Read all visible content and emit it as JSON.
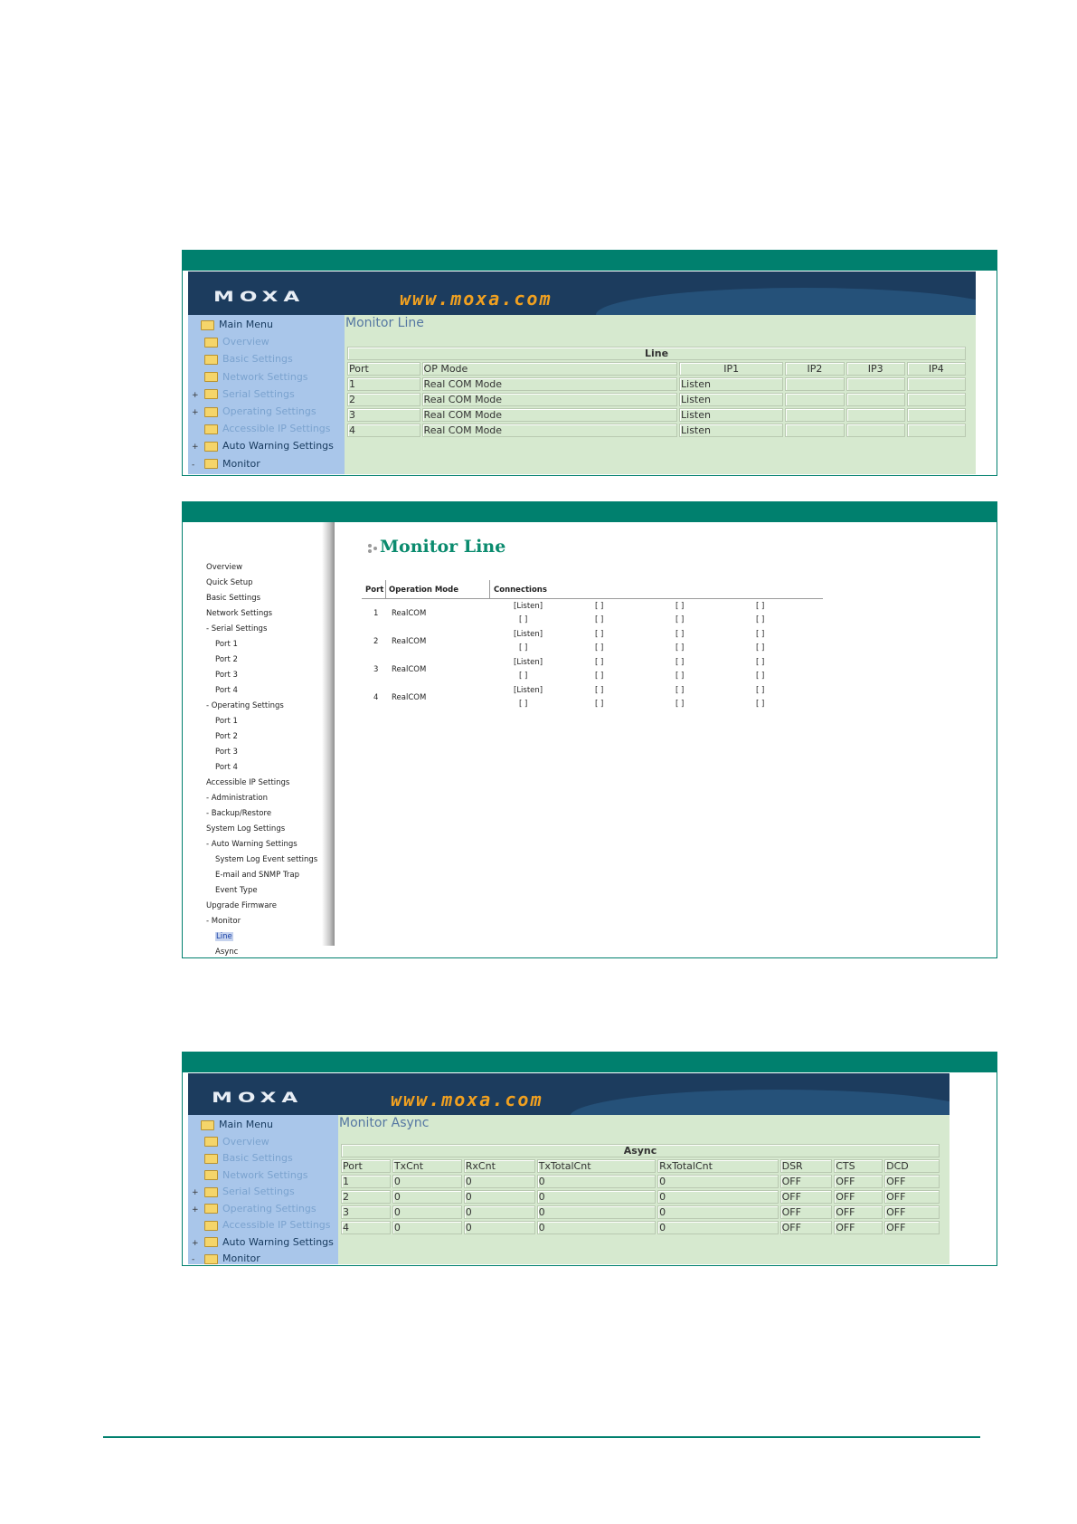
{
  "shot1": {
    "logo": "MOXA",
    "url": "www.moxa.com",
    "menu": [
      {
        "label": "Main Menu",
        "expander": "",
        "style": "dark",
        "open": true
      },
      {
        "label": "Overview",
        "expander": "",
        "style": "light"
      },
      {
        "label": "Basic Settings",
        "expander": "",
        "style": "light"
      },
      {
        "label": "Network Settings",
        "expander": "",
        "style": "light"
      },
      {
        "label": "Serial Settings",
        "expander": "+",
        "style": "light"
      },
      {
        "label": "Operating Settings",
        "expander": "+",
        "style": "light"
      },
      {
        "label": "Accessible IP Settings",
        "expander": "",
        "style": "light"
      },
      {
        "label": "Auto Warning Settings",
        "expander": "+",
        "style": "dark"
      },
      {
        "label": "Monitor",
        "expander": "-",
        "style": "dark"
      }
    ],
    "title": "Monitor Line",
    "caption": "Line",
    "columns": [
      "Port",
      "OP Mode",
      "IP1",
      "IP2",
      "IP3",
      "IP4"
    ],
    "rows": [
      [
        "1",
        "Real COM Mode",
        "Listen",
        "",
        "",
        ""
      ],
      [
        "2",
        "Real COM Mode",
        "Listen",
        "",
        "",
        ""
      ],
      [
        "3",
        "Real COM Mode",
        "Listen",
        "",
        "",
        ""
      ],
      [
        "4",
        "Real COM Mode",
        "Listen",
        "",
        "",
        ""
      ]
    ]
  },
  "shot2": {
    "title": "Monitor Line",
    "nav": [
      {
        "label": "Overview",
        "indent": 0
      },
      {
        "label": "Quick Setup",
        "indent": 0
      },
      {
        "label": "Basic Settings",
        "indent": 0
      },
      {
        "label": "Network Settings",
        "indent": 0
      },
      {
        "label": "- Serial Settings",
        "indent": 0
      },
      {
        "label": "Port 1",
        "indent": 1
      },
      {
        "label": "Port 2",
        "indent": 1
      },
      {
        "label": "Port 3",
        "indent": 1
      },
      {
        "label": "Port 4",
        "indent": 1
      },
      {
        "label": "- Operating Settings",
        "indent": 0
      },
      {
        "label": "Port 1",
        "indent": 1
      },
      {
        "label": "Port 2",
        "indent": 1
      },
      {
        "label": "Port 3",
        "indent": 1
      },
      {
        "label": "Port 4",
        "indent": 1
      },
      {
        "label": "Accessible IP Settings",
        "indent": 0
      },
      {
        "label": "- Administration",
        "indent": 0
      },
      {
        "label": "- Backup/Restore",
        "indent": 0
      },
      {
        "label": "System Log Settings",
        "indent": 0
      },
      {
        "label": "- Auto Warning Settings",
        "indent": 0
      },
      {
        "label": "System Log Event settings",
        "indent": 1
      },
      {
        "label": "E-mail and SNMP Trap",
        "indent": 1
      },
      {
        "label": "Event Type",
        "indent": 1
      },
      {
        "label": "Upgrade Firmware",
        "indent": 0
      },
      {
        "label": "- Monitor",
        "indent": 0
      },
      {
        "label": "Line",
        "indent": 1,
        "selected": true
      },
      {
        "label": "Async",
        "indent": 1
      }
    ],
    "headers": [
      "Port",
      "Operation Mode",
      "Connections"
    ],
    "rows": [
      {
        "port": "1",
        "mode": "RealCOM",
        "conn": [
          [
            "[Listen]",
            "[ ]",
            "[ ]",
            "[ ]"
          ],
          [
            "[ ]",
            "[ ]",
            "[ ]",
            "[ ]"
          ]
        ]
      },
      {
        "port": "2",
        "mode": "RealCOM",
        "conn": [
          [
            "[Listen]",
            "[ ]",
            "[ ]",
            "[ ]"
          ],
          [
            "[ ]",
            "[ ]",
            "[ ]",
            "[ ]"
          ]
        ]
      },
      {
        "port": "3",
        "mode": "RealCOM",
        "conn": [
          [
            "[Listen]",
            "[ ]",
            "[ ]",
            "[ ]"
          ],
          [
            "[ ]",
            "[ ]",
            "[ ]",
            "[ ]"
          ]
        ]
      },
      {
        "port": "4",
        "mode": "RealCOM",
        "conn": [
          [
            "[Listen]",
            "[ ]",
            "[ ]",
            "[ ]"
          ],
          [
            "[ ]",
            "[ ]",
            "[ ]",
            "[ ]"
          ]
        ]
      }
    ]
  },
  "shot3": {
    "logo": "MOXA",
    "url": "www.moxa.com",
    "menu": [
      {
        "label": "Main Menu",
        "expander": "",
        "style": "dark",
        "open": true
      },
      {
        "label": "Overview",
        "expander": "",
        "style": "light"
      },
      {
        "label": "Basic Settings",
        "expander": "",
        "style": "light"
      },
      {
        "label": "Network Settings",
        "expander": "",
        "style": "light"
      },
      {
        "label": "Serial Settings",
        "expander": "+",
        "style": "light"
      },
      {
        "label": "Operating Settings",
        "expander": "+",
        "style": "light"
      },
      {
        "label": "Accessible IP Settings",
        "expander": "",
        "style": "light"
      },
      {
        "label": "Auto Warning Settings",
        "expander": "+",
        "style": "dark"
      },
      {
        "label": "Monitor",
        "expander": "-",
        "style": "dark"
      }
    ],
    "title": "Monitor Async",
    "caption": "Async",
    "columns": [
      "Port",
      "TxCnt",
      "RxCnt",
      "TxTotalCnt",
      "RxTotalCnt",
      "DSR",
      "CTS",
      "DCD"
    ],
    "rows": [
      [
        "1",
        "0",
        "0",
        "0",
        "0",
        "OFF",
        "OFF",
        "OFF"
      ],
      [
        "2",
        "0",
        "0",
        "0",
        "0",
        "OFF",
        "OFF",
        "OFF"
      ],
      [
        "3",
        "0",
        "0",
        "0",
        "0",
        "OFF",
        "OFF",
        "OFF"
      ],
      [
        "4",
        "0",
        "0",
        "0",
        "0",
        "OFF",
        "OFF",
        "OFF"
      ]
    ]
  }
}
